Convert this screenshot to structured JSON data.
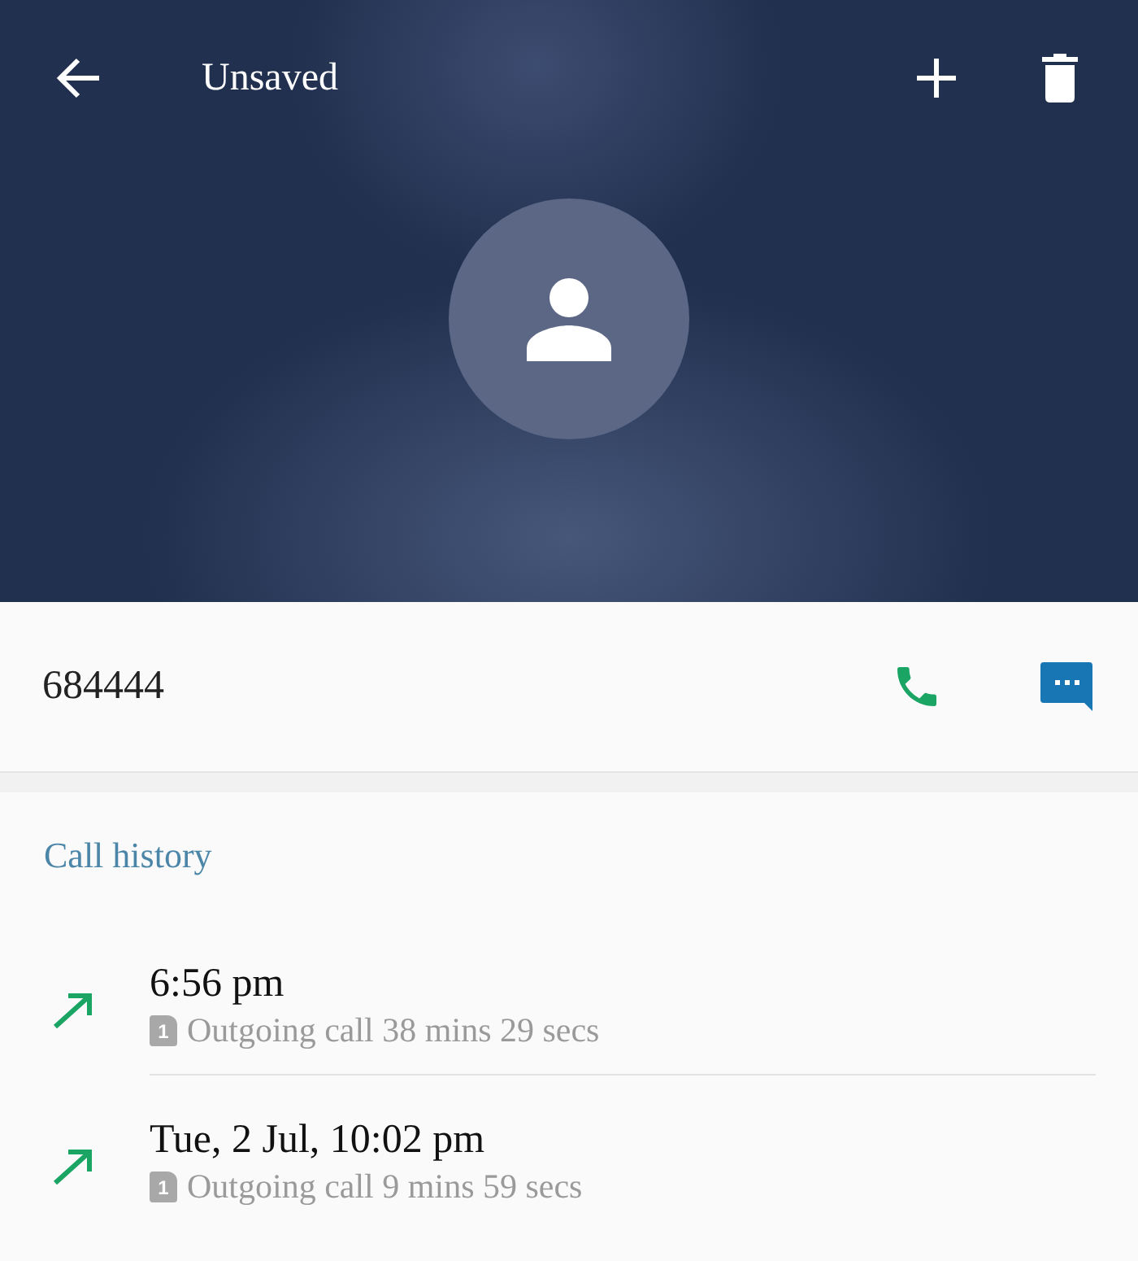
{
  "header": {
    "title": "Unsaved"
  },
  "number": "684444",
  "history": {
    "title": "Call history",
    "calls": [
      {
        "kind": "outgoing",
        "time": "6:56 pm",
        "sim": "1",
        "detail": "Outgoing call 38 mins 29 secs"
      },
      {
        "kind": "outgoing",
        "time": "Tue, 2 Jul, 10:02 pm",
        "sim": "1",
        "detail": "Outgoing call 9 mins 59 secs"
      }
    ]
  }
}
